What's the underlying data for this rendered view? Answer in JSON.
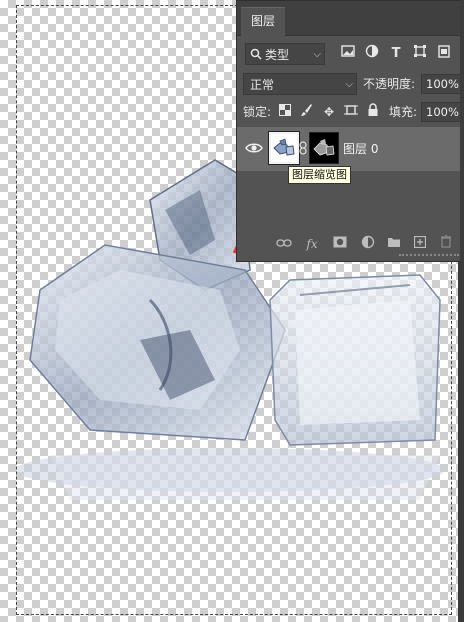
{
  "panel": {
    "tab_title": "图层",
    "filter": {
      "label": "类型",
      "icon": "search-icon"
    },
    "filter_buttons": [
      "image-filter-icon",
      "adjustment-filter-icon",
      "type-filter-icon",
      "shape-filter-icon",
      "smart-object-filter-icon"
    ],
    "blend_mode": "正常",
    "opacity_label": "不透明度:",
    "opacity_value": "100%",
    "lock_label": "锁定:",
    "fill_label": "填充:",
    "fill_value": "100%",
    "layers": [
      {
        "name": "图层 0",
        "visible": true,
        "selected": true
      }
    ],
    "bottom_icons": [
      "link-layers-icon",
      "fx-icon",
      "add-mask-icon",
      "adjustment-layer-icon",
      "group-folder-icon",
      "new-layer-icon",
      "trash-icon"
    ],
    "fx_label": "fx"
  },
  "tooltip": "图层缩览图",
  "colors": {
    "panel_bg": "#535353",
    "arrow": "#e53935",
    "selected_layer": "#6b6b6b"
  }
}
